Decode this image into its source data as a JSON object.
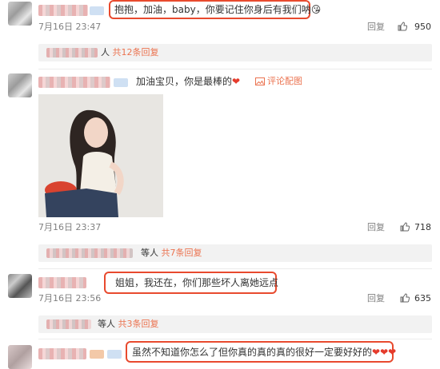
{
  "comments": [
    {
      "text": "抱抱，加油，baby，你要记住你身后有我们呐",
      "emoji": "😘",
      "time": "7月16日 23:47",
      "reply_label": "回复",
      "likes": "950",
      "sub": {
        "suffix": "人",
        "link": "共12条回复"
      }
    },
    {
      "text": "加油宝贝，你是最棒的",
      "heart": "❤",
      "tag": "评论配图",
      "time": "7月16日 23:37",
      "reply_label": "回复",
      "likes": "718",
      "sub": {
        "suffix": "等人",
        "link": "共7条回复"
      }
    },
    {
      "text": "姐姐，我还在，你们那些坏人离她远点",
      "time": "7月16日 23:56",
      "reply_label": "回复",
      "likes": "635",
      "sub": {
        "suffix": "等人",
        "link": "共3条回复"
      }
    },
    {
      "text": "虽然不知道你怎么了但你真的真的真的很好一定要好好的",
      "hearts": "❤❤❤"
    }
  ],
  "colors": {
    "highlight_box": "#e84a2e",
    "link": "#eb7350",
    "heart": "#e53b2c",
    "muted": "#808080"
  },
  "icons": [
    "thumb-up-icon",
    "image-icon",
    "heart-icon"
  ]
}
